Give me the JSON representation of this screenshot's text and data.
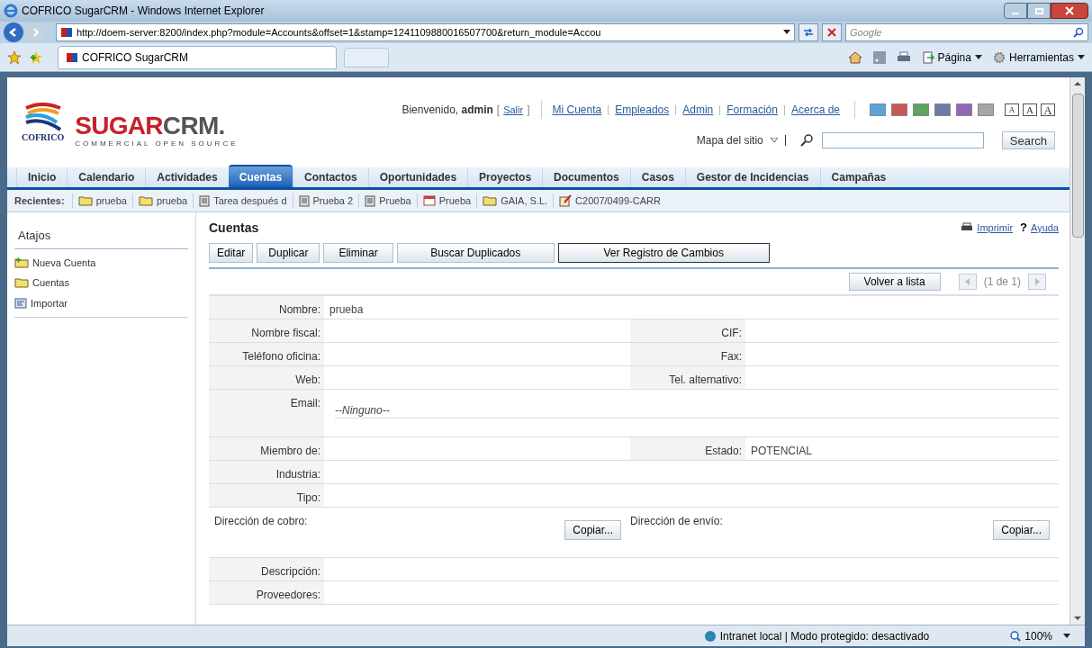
{
  "browser": {
    "title": "COFRICO SugarCRM - Windows Internet Explorer",
    "url": "http://doem-server:8200/index.php?module=Accounts&offset=1&stamp=1241109880016507700&return_module=Accou",
    "search_placeholder": "Google",
    "tab": "COFRICO SugarCRM",
    "menus": [
      "Página",
      "Herramientas"
    ],
    "status": "Intranet local | Modo protegido: desactivado",
    "zoom": "100%"
  },
  "header": {
    "logo_company": "COFRICO",
    "brand": [
      "SUGAR",
      "CRM."
    ],
    "tagline": "COMMERCIAL OPEN SOURCE",
    "welcome": "Bienvenido, **admin**",
    "bracket_open": "[",
    "logout": "Salir",
    "bracket_close": "]",
    "links": [
      "Mi Cuenta",
      "Empleados",
      "Admin",
      "Formación",
      "Acerca de"
    ],
    "themes": [
      {
        "color": "#5ba3dc"
      },
      {
        "color": "#cc5555"
      },
      {
        "color": "#5fa55f"
      },
      {
        "color": "#6b7aa8"
      },
      {
        "color": "#9466b8"
      },
      {
        "color": "#a6a6a6"
      }
    ],
    "font_sizes": [
      "A",
      "A",
      "A"
    ],
    "sitemap": "Mapa del sitio",
    "search_button": "Search"
  },
  "tabs": [
    {
      "label": "Inicio",
      "selected": false
    },
    {
      "label": "Calendario",
      "selected": false
    },
    {
      "label": "Actividades",
      "selected": false
    },
    {
      "label": "Cuentas",
      "selected": true
    },
    {
      "label": "Contactos",
      "selected": false
    },
    {
      "label": "Oportunidades",
      "selected": false
    },
    {
      "label": "Proyectos",
      "selected": false
    },
    {
      "label": "Documentos",
      "selected": false
    },
    {
      "label": "Casos",
      "selected": false
    },
    {
      "label": "Gestor de Incidencias",
      "selected": false
    },
    {
      "label": "Campañas",
      "selected": false
    }
  ],
  "recents": {
    "label": "Recientes:",
    "items": [
      {
        "kind": "folder",
        "label": "prueba"
      },
      {
        "kind": "folder",
        "label": "prueba"
      },
      {
        "kind": "task",
        "label": "Tarea después d"
      },
      {
        "kind": "task",
        "label": "Prueba 2"
      },
      {
        "kind": "task",
        "label": "Prueba"
      },
      {
        "kind": "calendar",
        "label": "Prueba"
      },
      {
        "kind": "folder",
        "label": "GAIA, S.L."
      },
      {
        "kind": "note",
        "label": "C2007/0499-CARR"
      }
    ]
  },
  "sidebar": {
    "title": "Atajos",
    "items": [
      {
        "kind": "new",
        "label": "Nueva Cuenta"
      },
      {
        "kind": "folder",
        "label": "Cuentas"
      },
      {
        "kind": "import",
        "label": "Importar"
      }
    ]
  },
  "detail": {
    "title": "Cuentas",
    "print": "Imprimir",
    "help_icon": "?",
    "help": "Ayuda",
    "buttons": [
      "Editar",
      "Duplicar",
      "Eliminar",
      "Buscar Duplicados",
      "Ver Registro de Cambios"
    ],
    "back": "Volver a lista",
    "pager": "(1 de 1)",
    "rows": [
      {
        "kind": "single",
        "cells": [
          {
            "label": "Nombre:",
            "value": "prueba"
          }
        ]
      },
      {
        "kind": "pair",
        "cells": [
          {
            "label": "Nombre fiscal:"
          },
          {
            "label": "CIF:"
          }
        ]
      },
      {
        "kind": "pair",
        "cells": [
          {
            "label": "Teléfono oficina:"
          },
          {
            "label": "Fax:"
          }
        ]
      },
      {
        "kind": "pair",
        "cells": [
          {
            "label": "Web:"
          },
          {
            "label": "Tel. alternativo:"
          }
        ]
      },
      {
        "kind": "email",
        "cells": [
          {
            "label": "Email:",
            "value": "--Ninguno--"
          }
        ]
      },
      {
        "kind": "pair",
        "cells": [
          {
            "label": "Miembro de:"
          },
          {
            "label": "Estado:",
            "value": "POTENCIAL"
          }
        ]
      },
      {
        "kind": "single",
        "cells": [
          {
            "label": "Industria:"
          }
        ]
      },
      {
        "kind": "single",
        "cells": [
          {
            "label": "Tipo:"
          }
        ]
      },
      {
        "kind": "address",
        "cells": [
          {
            "label": "Dirección de cobro:",
            "button": "Copiar..."
          },
          {
            "label": "Dirección de envío:",
            "button": "Copiar..."
          }
        ]
      },
      {
        "kind": "single",
        "cells": [
          {
            "label": "Descripción:"
          }
        ]
      },
      {
        "kind": "single",
        "cells": [
          {
            "label": "Proveedores:"
          }
        ]
      }
    ]
  }
}
